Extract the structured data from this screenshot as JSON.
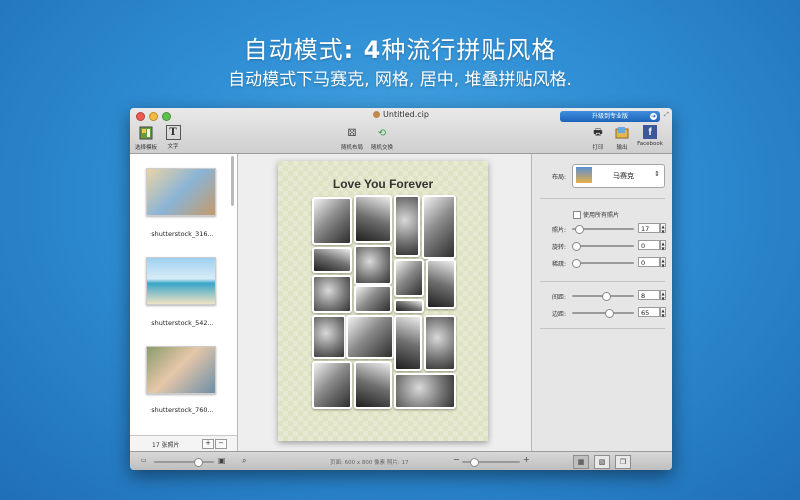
{
  "hero": {
    "title_prefix": "自动模式",
    "title_bold": ": 4",
    "title_suffix": "种流行拼贴风格",
    "subtitle": "自动模式下马赛克, 网格, 居中, 堆叠拼贴风格."
  },
  "window": {
    "title": "Untitled.cip",
    "upgrade_label": "升级到专业版",
    "toolbar": {
      "select_template": "选择模板",
      "text": "文字",
      "random_layout": "随机布局",
      "random_swap": "随机交换",
      "print": "打印",
      "export": "输出",
      "facebook": "Facebook"
    }
  },
  "sidebar": {
    "items": [
      {
        "label": "shutterstock_316..."
      },
      {
        "label": "shutterstock_542..."
      },
      {
        "label": "shutterstock_760..."
      }
    ],
    "photo_count": "17 张照片",
    "add_label": "+",
    "remove_label": "−"
  },
  "collage": {
    "title": "Love You Forever"
  },
  "inspector": {
    "layout_label": "布局:",
    "layout_value": "马赛克",
    "use_all_photos": "使用所有照片",
    "photos_label": "照片:",
    "photos_value": "17",
    "photos_fraction": 0.05,
    "rotate_label": "旋转:",
    "rotate_value": "0",
    "rotate_fraction": 0.0,
    "sparse_label": "稀疏:",
    "sparse_value": "0",
    "sparse_fraction": 0.0,
    "spacing_label": "间距:",
    "spacing_value": "8",
    "spacing_fraction": 0.55,
    "margin_label": "边距:",
    "margin_value": "65",
    "margin_fraction": 0.6
  },
  "bottombar": {
    "status": "页面: 600 x 800 像素  照片: 17",
    "thumb_size_fraction": 0.75,
    "zoom_fraction": 0.15
  }
}
